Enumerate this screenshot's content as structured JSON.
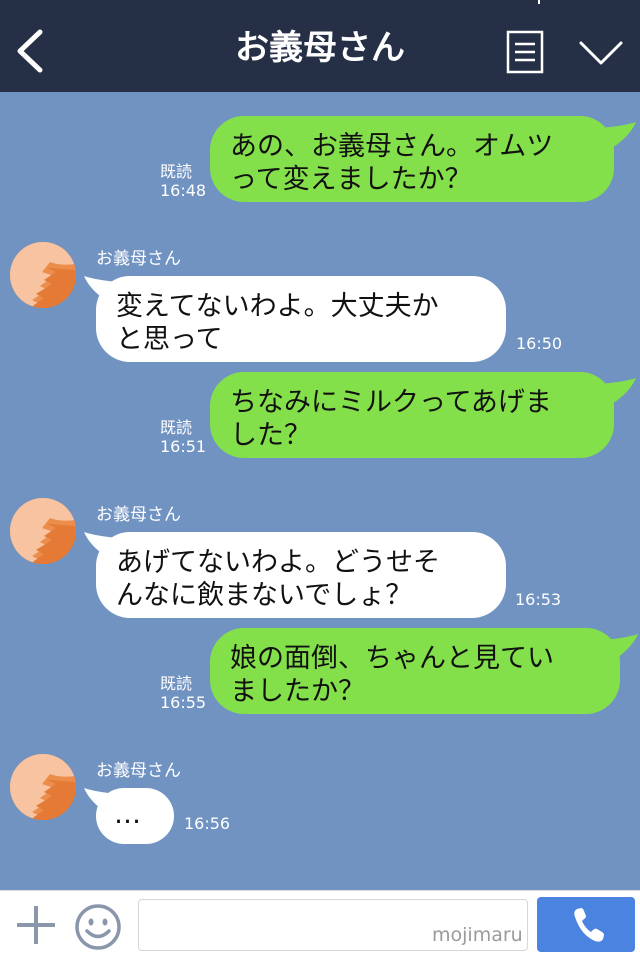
{
  "header": {
    "title": "お義母さん",
    "back_icon": "chevron-left-icon",
    "menu_icon": "list-menu-icon",
    "down_icon": "chevron-down-icon"
  },
  "colors": {
    "header_bg": "#252f45",
    "chat_bg": "#7093c2",
    "outgoing_bubble": "#84e04a",
    "incoming_bubble": "#ffffff",
    "call_button": "#4a83e0"
  },
  "messages": [
    {
      "direction": "out",
      "lines": [
        "あの、お義母さん。オムツ",
        "って変えましたか？"
      ],
      "read_label": "既読",
      "time": "16:48"
    },
    {
      "direction": "in",
      "sender": "お義母さん",
      "lines": [
        "変えてないわよ。大丈夫か",
        "と思って"
      ],
      "time": "16:50"
    },
    {
      "direction": "out",
      "lines": [
        "ちなみにミルクってあげま",
        "した？"
      ],
      "read_label": "既読",
      "time": "16:51"
    },
    {
      "direction": "in",
      "sender": "お義母さん",
      "lines": [
        "あげてないわよ。どうせそ",
        "んなに飲まないでしょ？"
      ],
      "time": "16:53"
    },
    {
      "direction": "out",
      "lines": [
        "娘の面倒、ちゃんと見てい",
        "ましたか？"
      ],
      "read_label": "既読",
      "time": "16:55"
    },
    {
      "direction": "in",
      "sender": "お義母さん",
      "lines": [
        "…"
      ],
      "time": "16:56"
    }
  ],
  "input_bar": {
    "plus_icon": "plus-icon",
    "emoji_icon": "smiley-icon",
    "placeholder": "",
    "watermark": "mojimaru",
    "call_icon": "phone-icon"
  }
}
